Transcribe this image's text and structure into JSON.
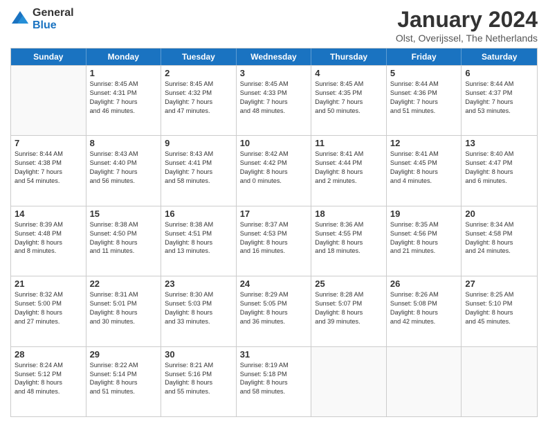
{
  "header": {
    "logo_line1": "General",
    "logo_line2": "Blue",
    "title": "January 2024",
    "subtitle": "Olst, Overijssel, The Netherlands"
  },
  "days": [
    "Sunday",
    "Monday",
    "Tuesday",
    "Wednesday",
    "Thursday",
    "Friday",
    "Saturday"
  ],
  "weeks": [
    [
      {
        "num": "",
        "lines": []
      },
      {
        "num": "1",
        "lines": [
          "Sunrise: 8:45 AM",
          "Sunset: 4:31 PM",
          "Daylight: 7 hours",
          "and 46 minutes."
        ]
      },
      {
        "num": "2",
        "lines": [
          "Sunrise: 8:45 AM",
          "Sunset: 4:32 PM",
          "Daylight: 7 hours",
          "and 47 minutes."
        ]
      },
      {
        "num": "3",
        "lines": [
          "Sunrise: 8:45 AM",
          "Sunset: 4:33 PM",
          "Daylight: 7 hours",
          "and 48 minutes."
        ]
      },
      {
        "num": "4",
        "lines": [
          "Sunrise: 8:45 AM",
          "Sunset: 4:35 PM",
          "Daylight: 7 hours",
          "and 50 minutes."
        ]
      },
      {
        "num": "5",
        "lines": [
          "Sunrise: 8:44 AM",
          "Sunset: 4:36 PM",
          "Daylight: 7 hours",
          "and 51 minutes."
        ]
      },
      {
        "num": "6",
        "lines": [
          "Sunrise: 8:44 AM",
          "Sunset: 4:37 PM",
          "Daylight: 7 hours",
          "and 53 minutes."
        ]
      }
    ],
    [
      {
        "num": "7",
        "lines": [
          "Sunrise: 8:44 AM",
          "Sunset: 4:38 PM",
          "Daylight: 7 hours",
          "and 54 minutes."
        ]
      },
      {
        "num": "8",
        "lines": [
          "Sunrise: 8:43 AM",
          "Sunset: 4:40 PM",
          "Daylight: 7 hours",
          "and 56 minutes."
        ]
      },
      {
        "num": "9",
        "lines": [
          "Sunrise: 8:43 AM",
          "Sunset: 4:41 PM",
          "Daylight: 7 hours",
          "and 58 minutes."
        ]
      },
      {
        "num": "10",
        "lines": [
          "Sunrise: 8:42 AM",
          "Sunset: 4:42 PM",
          "Daylight: 8 hours",
          "and 0 minutes."
        ]
      },
      {
        "num": "11",
        "lines": [
          "Sunrise: 8:41 AM",
          "Sunset: 4:44 PM",
          "Daylight: 8 hours",
          "and 2 minutes."
        ]
      },
      {
        "num": "12",
        "lines": [
          "Sunrise: 8:41 AM",
          "Sunset: 4:45 PM",
          "Daylight: 8 hours",
          "and 4 minutes."
        ]
      },
      {
        "num": "13",
        "lines": [
          "Sunrise: 8:40 AM",
          "Sunset: 4:47 PM",
          "Daylight: 8 hours",
          "and 6 minutes."
        ]
      }
    ],
    [
      {
        "num": "14",
        "lines": [
          "Sunrise: 8:39 AM",
          "Sunset: 4:48 PM",
          "Daylight: 8 hours",
          "and 8 minutes."
        ]
      },
      {
        "num": "15",
        "lines": [
          "Sunrise: 8:38 AM",
          "Sunset: 4:50 PM",
          "Daylight: 8 hours",
          "and 11 minutes."
        ]
      },
      {
        "num": "16",
        "lines": [
          "Sunrise: 8:38 AM",
          "Sunset: 4:51 PM",
          "Daylight: 8 hours",
          "and 13 minutes."
        ]
      },
      {
        "num": "17",
        "lines": [
          "Sunrise: 8:37 AM",
          "Sunset: 4:53 PM",
          "Daylight: 8 hours",
          "and 16 minutes."
        ]
      },
      {
        "num": "18",
        "lines": [
          "Sunrise: 8:36 AM",
          "Sunset: 4:55 PM",
          "Daylight: 8 hours",
          "and 18 minutes."
        ]
      },
      {
        "num": "19",
        "lines": [
          "Sunrise: 8:35 AM",
          "Sunset: 4:56 PM",
          "Daylight: 8 hours",
          "and 21 minutes."
        ]
      },
      {
        "num": "20",
        "lines": [
          "Sunrise: 8:34 AM",
          "Sunset: 4:58 PM",
          "Daylight: 8 hours",
          "and 24 minutes."
        ]
      }
    ],
    [
      {
        "num": "21",
        "lines": [
          "Sunrise: 8:32 AM",
          "Sunset: 5:00 PM",
          "Daylight: 8 hours",
          "and 27 minutes."
        ]
      },
      {
        "num": "22",
        "lines": [
          "Sunrise: 8:31 AM",
          "Sunset: 5:01 PM",
          "Daylight: 8 hours",
          "and 30 minutes."
        ]
      },
      {
        "num": "23",
        "lines": [
          "Sunrise: 8:30 AM",
          "Sunset: 5:03 PM",
          "Daylight: 8 hours",
          "and 33 minutes."
        ]
      },
      {
        "num": "24",
        "lines": [
          "Sunrise: 8:29 AM",
          "Sunset: 5:05 PM",
          "Daylight: 8 hours",
          "and 36 minutes."
        ]
      },
      {
        "num": "25",
        "lines": [
          "Sunrise: 8:28 AM",
          "Sunset: 5:07 PM",
          "Daylight: 8 hours",
          "and 39 minutes."
        ]
      },
      {
        "num": "26",
        "lines": [
          "Sunrise: 8:26 AM",
          "Sunset: 5:08 PM",
          "Daylight: 8 hours",
          "and 42 minutes."
        ]
      },
      {
        "num": "27",
        "lines": [
          "Sunrise: 8:25 AM",
          "Sunset: 5:10 PM",
          "Daylight: 8 hours",
          "and 45 minutes."
        ]
      }
    ],
    [
      {
        "num": "28",
        "lines": [
          "Sunrise: 8:24 AM",
          "Sunset: 5:12 PM",
          "Daylight: 8 hours",
          "and 48 minutes."
        ]
      },
      {
        "num": "29",
        "lines": [
          "Sunrise: 8:22 AM",
          "Sunset: 5:14 PM",
          "Daylight: 8 hours",
          "and 51 minutes."
        ]
      },
      {
        "num": "30",
        "lines": [
          "Sunrise: 8:21 AM",
          "Sunset: 5:16 PM",
          "Daylight: 8 hours",
          "and 55 minutes."
        ]
      },
      {
        "num": "31",
        "lines": [
          "Sunrise: 8:19 AM",
          "Sunset: 5:18 PM",
          "Daylight: 8 hours",
          "and 58 minutes."
        ]
      },
      {
        "num": "",
        "lines": []
      },
      {
        "num": "",
        "lines": []
      },
      {
        "num": "",
        "lines": []
      }
    ]
  ]
}
